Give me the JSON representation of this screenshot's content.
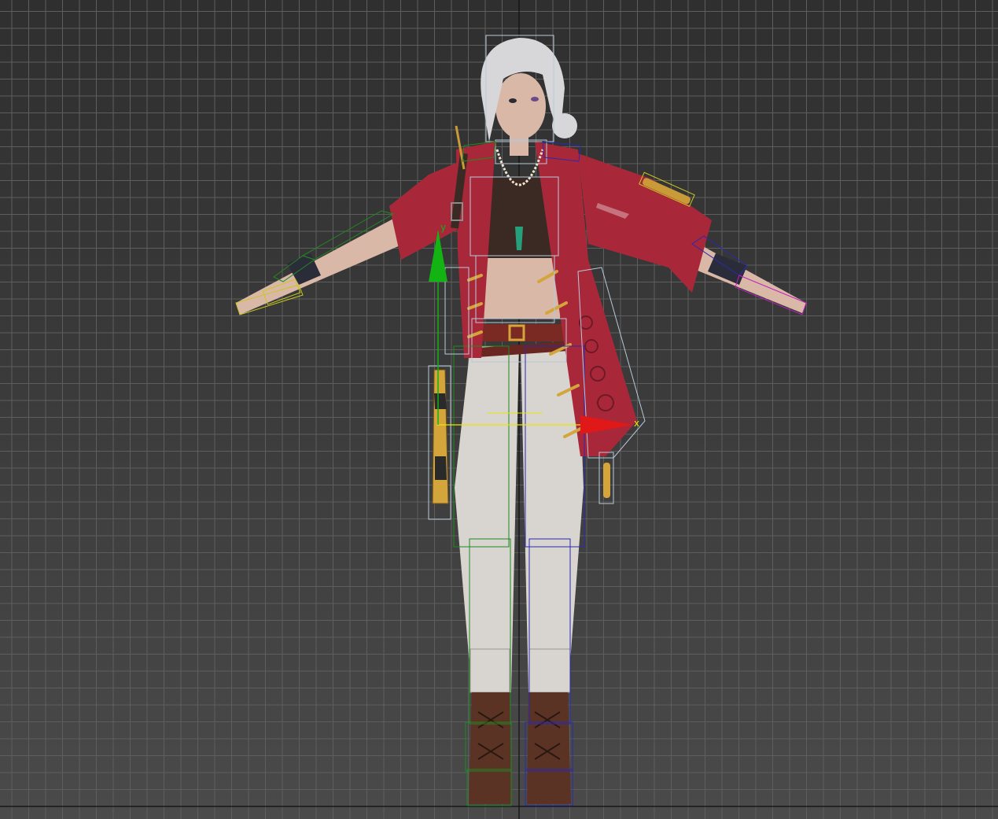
{
  "viewport": {
    "grid_color": "#5e5e5e",
    "major_axis_color": "#101010"
  },
  "gizmo": {
    "y_axis_label": "y",
    "x_axis_label": "x",
    "y_color": "#12b312",
    "x_color": "#e01818",
    "plane_color": "#e8e800"
  },
  "bone_colors": {
    "left": "#1f8a1f",
    "right": "#2a2ab0",
    "spine": "#b8c8d8",
    "left_hand": "#c8c820",
    "right_hand": "#c020c0"
  },
  "character": {
    "coat_color": "#a8283a",
    "skin_color": "#d9b8a8",
    "hair_color": "#d7d7da",
    "pants_color": "#d8d4cf",
    "boot_color": "#5a3324",
    "top_color": "#3b2a24"
  }
}
